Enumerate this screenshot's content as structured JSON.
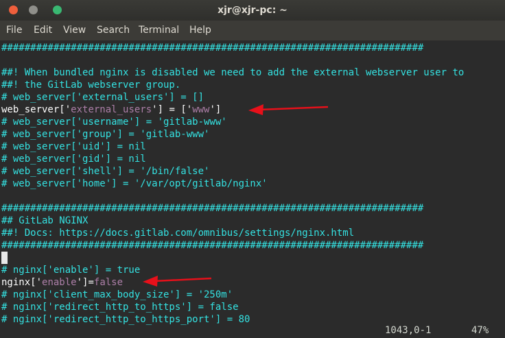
{
  "window": {
    "title": "xjr@xjr-pc: ~",
    "colors": {
      "close": "#ef5f3c",
      "minimize": "#8f8f8a",
      "maximize": "#39b872",
      "background": "#2b2b2b",
      "comment": "#34e2e2",
      "string": "#ad7fa8",
      "text": "#ffffff",
      "annotation_arrow": "#e8101a"
    }
  },
  "menu": [
    "File",
    "Edit",
    "View",
    "Search",
    "Terminal",
    "Help"
  ],
  "lines": {
    "hashes1": "#########################################################################",
    "blank1": "",
    "c1": "##! When bundled nginx is disabled we need to add the external webserver user to",
    "c2": "##! the GitLab webserver group.",
    "c3": "# web_server['external_users'] = []",
    "ws_a": "web_server['",
    "ws_b": "external_users",
    "ws_c": "'] = ['",
    "ws_d": "www",
    "ws_e": "']",
    "c4": "# web_server['username'] = 'gitlab-www'",
    "c5": "# web_server['group'] = 'gitlab-www'",
    "c6": "# web_server['uid'] = nil",
    "c7": "# web_server['gid'] = nil",
    "c8": "# web_server['shell'] = '/bin/false'",
    "c9": "# web_server['home'] = '/var/opt/gitlab/nginx'",
    "hashes2": "#########################################################################",
    "c10": "## GitLab NGINX",
    "c11": "##! Docs: https://docs.gitlab.com/omnibus/settings/nginx.html",
    "hashes3": "#########################################################################",
    "c12": "# nginx['enable'] = true",
    "ng_a": "nginx['",
    "ng_b": "enable",
    "ng_c": "']=",
    "ng_d": "false",
    "c13": "# nginx['client_max_body_size'] = '250m'",
    "c14": "# nginx['redirect_http_to_https'] = false",
    "c15": "# nginx['redirect_http_to_https_port'] = 80"
  },
  "status": {
    "position": "1043,0-1",
    "percent": "47%"
  }
}
